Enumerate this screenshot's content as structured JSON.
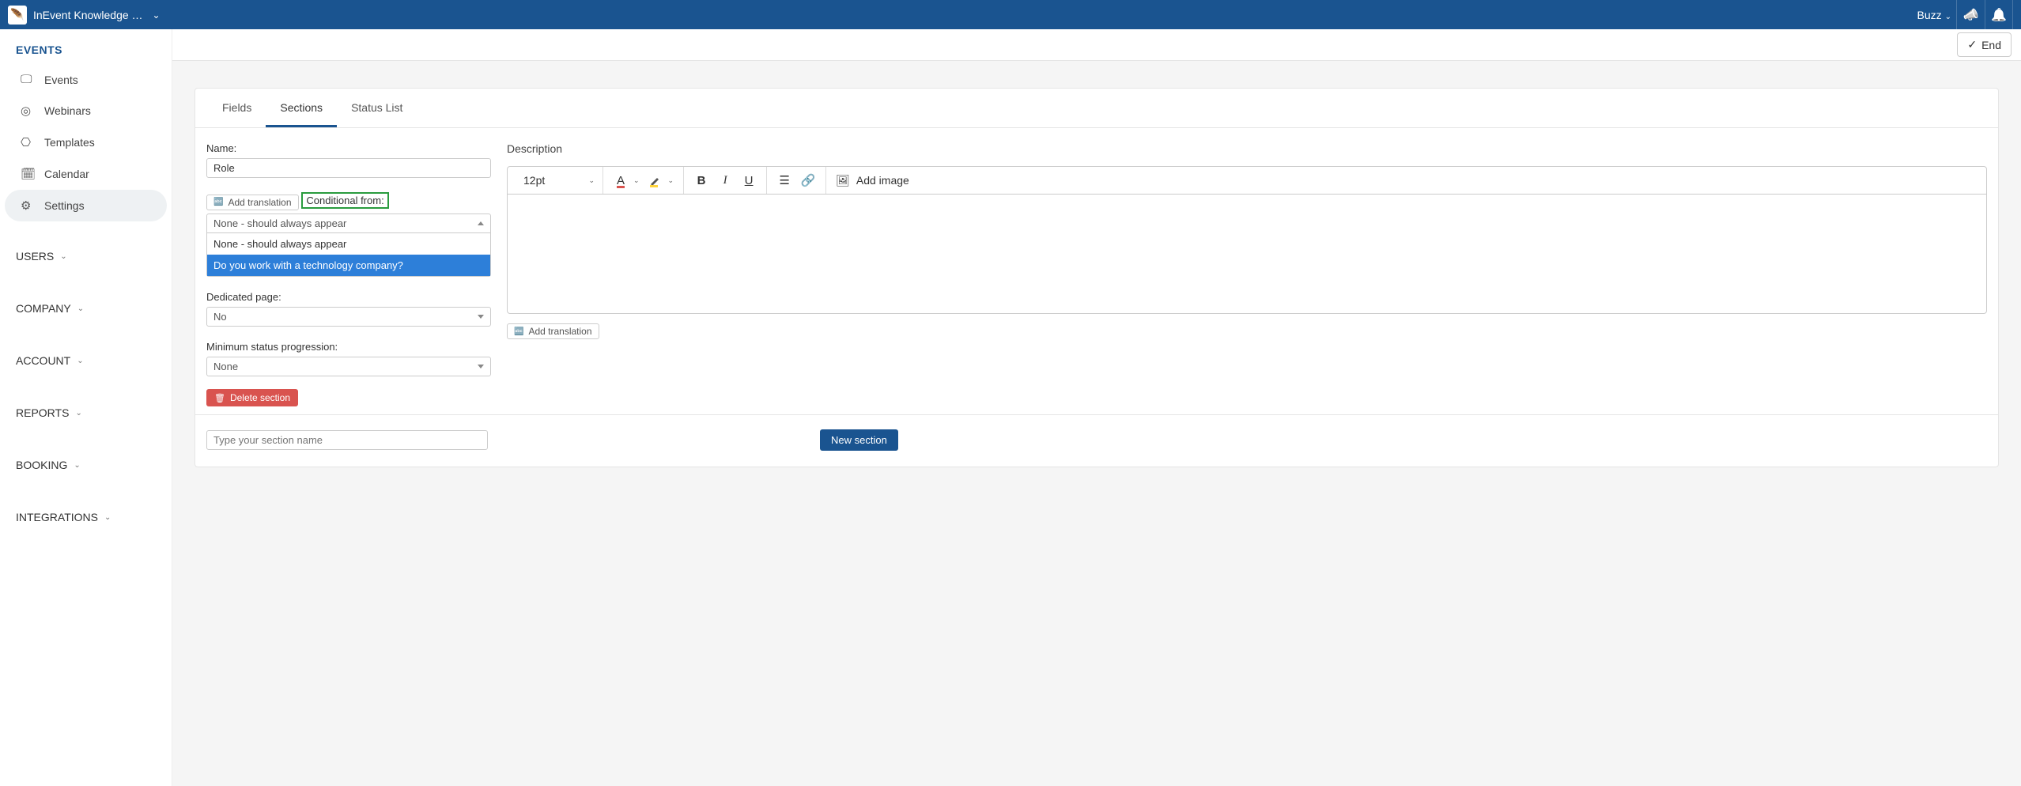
{
  "topbar": {
    "brand": "InEvent Knowledge …",
    "user": "Buzz"
  },
  "actionbar": {
    "end": "End"
  },
  "sidebar": {
    "header": "EVENTS",
    "items": [
      {
        "label": "Events"
      },
      {
        "label": "Webinars"
      },
      {
        "label": "Templates"
      },
      {
        "label": "Calendar"
      },
      {
        "label": "Settings"
      }
    ],
    "groups": [
      {
        "label": "USERS"
      },
      {
        "label": "COMPANY"
      },
      {
        "label": "ACCOUNT"
      },
      {
        "label": "REPORTS"
      },
      {
        "label": "BOOKING"
      },
      {
        "label": "INTEGRATIONS"
      }
    ]
  },
  "tabs": {
    "fields": "Fields",
    "sections": "Sections",
    "status_list": "Status List"
  },
  "form": {
    "name_label": "Name:",
    "name_value": "Role",
    "add_translation": "Add translation",
    "conditional_label": "Conditional from:",
    "conditional_selected": "None - should always appear",
    "conditional_options": {
      "none": "None - should always appear",
      "tech": "Do you work with a technology company?"
    },
    "dedicated_label": "Dedicated page:",
    "dedicated_value": "No",
    "min_status_label": "Minimum status progression:",
    "min_status_value": "None",
    "delete": "Delete section"
  },
  "desc": {
    "label": "Description",
    "font_size": "12pt",
    "bold": "B",
    "italic": "I",
    "underline": "U",
    "add_image": "Add image",
    "add_translation": "Add translation"
  },
  "new_section": {
    "placeholder": "Type your section name",
    "button": "New section"
  }
}
